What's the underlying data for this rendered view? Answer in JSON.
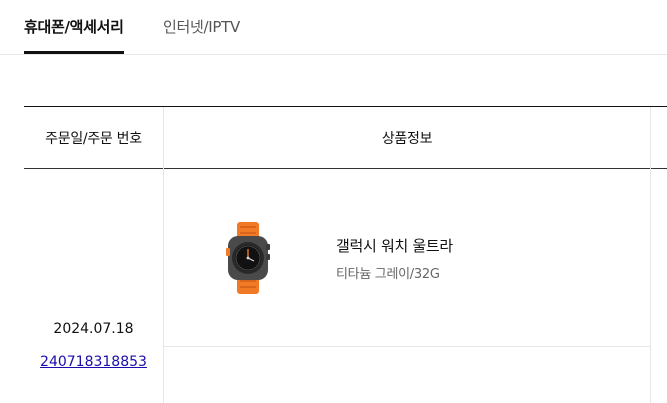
{
  "tabs": [
    {
      "label": "휴대폰/액세서리",
      "active": true
    },
    {
      "label": "인터넷/IPTV",
      "active": false
    }
  ],
  "table": {
    "headers": {
      "order": "주문일/주문 번호",
      "product": "상품정보"
    },
    "rows": [
      {
        "order_date": "2024.07.18",
        "order_number": "240718318853",
        "product": {
          "name": "갤럭시 워치 울트라",
          "option": "티타늄 그레이/32G",
          "icon": "smartwatch-icon"
        }
      }
    ]
  },
  "colors": {
    "accent": "#111111",
    "link": "#1a0dab",
    "strap": "#f07a25"
  }
}
